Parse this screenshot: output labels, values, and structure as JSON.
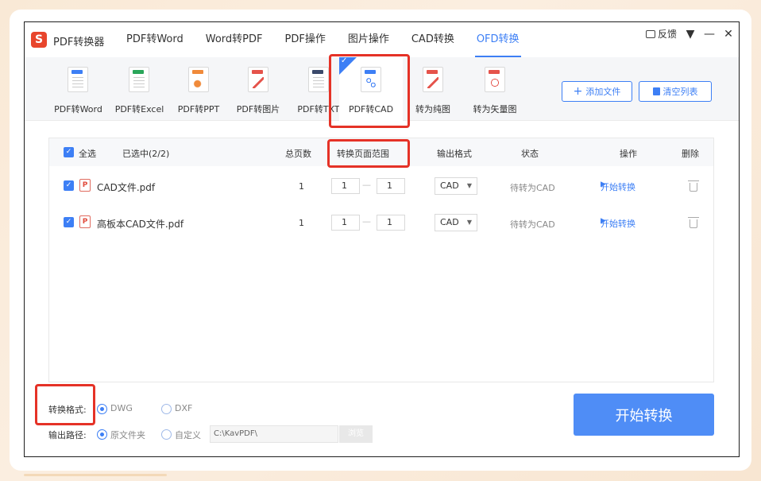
{
  "app": {
    "logo_glyph": "S",
    "name": "PDF转换器",
    "feedback": "反馈",
    "tabs": [
      {
        "label": "PDF转Word",
        "active": false
      },
      {
        "label": "Word转PDF",
        "active": false
      },
      {
        "label": "PDF操作",
        "active": false
      },
      {
        "label": "图片操作",
        "active": false
      },
      {
        "label": "CAD转换",
        "active": false
      },
      {
        "label": "OFD转换",
        "active": true
      }
    ],
    "window_controls": [
      "▼",
      "—",
      "✕"
    ]
  },
  "toolbar": {
    "tools": [
      {
        "label": "PDF转Word",
        "icon": "word-file-icon",
        "color": "#3d7ff5"
      },
      {
        "label": "PDF转Excel",
        "icon": "excel-file-icon",
        "color": "#2aa65a"
      },
      {
        "label": "PDF转PPT",
        "icon": "ppt-file-icon",
        "color": "#f08a3a"
      },
      {
        "label": "PDF转图片",
        "icon": "image-file-icon",
        "color": "#e5534b"
      },
      {
        "label": "PDF转TXT",
        "icon": "txt-file-icon",
        "color": "#3b4a6b"
      },
      {
        "label": "PDF转CAD",
        "icon": "cad-file-icon",
        "color": "#3d7ff5",
        "active": true
      },
      {
        "label": "转为纯图",
        "icon": "pure-image-file-icon",
        "color": "#e5534b"
      },
      {
        "label": "转为矢量图",
        "icon": "vector-file-icon",
        "color": "#e5534b"
      }
    ],
    "add_file": "添加文件",
    "clear_list": "清空列表"
  },
  "table": {
    "headers": {
      "select_all": "全选",
      "selected": "已选中(2/2)",
      "pages": "总页数",
      "range": "转换页面范围",
      "format": "输出格式",
      "status": "状态",
      "action": "操作",
      "delete": "删除"
    },
    "rows": [
      {
        "name": "CAD文件.pdf",
        "pages": "1",
        "from": "1",
        "to": "1",
        "format": "CAD",
        "status": "待转为CAD",
        "action": "开始转换"
      },
      {
        "name": "高板本CAD文件.pdf",
        "pages": "1",
        "from": "1",
        "to": "1",
        "format": "CAD",
        "status": "待转为CAD",
        "action": "开始转换"
      }
    ]
  },
  "bottom": {
    "format_label": "转换格式:",
    "format_options": [
      {
        "label": "DWG",
        "checked": true
      },
      {
        "label": "DXF",
        "checked": false
      }
    ],
    "path_label": "输出路径:",
    "path_options": [
      {
        "label": "原文件夹",
        "checked": true
      },
      {
        "label": "自定义",
        "checked": false
      }
    ],
    "path_value": "C:\\KavPDF\\",
    "browse": "浏览",
    "start": "开始转换"
  },
  "colors": {
    "accent": "#3d7ff5",
    "highlight_box": "#e53227"
  }
}
